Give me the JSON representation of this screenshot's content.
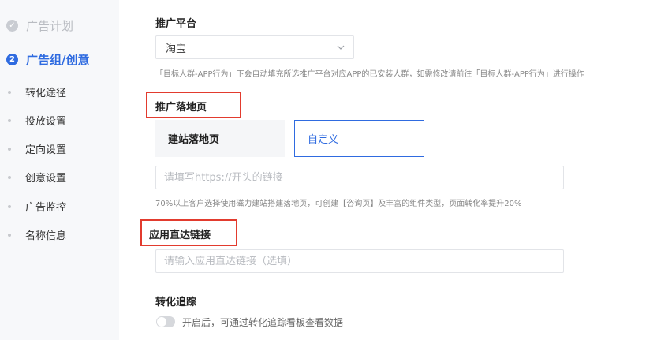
{
  "sidebar": {
    "step1": {
      "number": "✓",
      "label": "广告计划"
    },
    "step2": {
      "number": "2",
      "label": "广告组/创意"
    },
    "items": [
      {
        "label": "转化途径"
      },
      {
        "label": "投放设置"
      },
      {
        "label": "定向设置"
      },
      {
        "label": "创意设置"
      },
      {
        "label": "广告监控"
      },
      {
        "label": "名称信息"
      }
    ]
  },
  "platform": {
    "label": "推广平台",
    "selected": "淘宝",
    "hint": "「目标人群-APP行为」下会自动填充所选推广平台对应APP的已安装人群，如需修改请前往「目标人群-APP行为」进行操作"
  },
  "landing": {
    "label": "推广落地页",
    "tabs": [
      "建站落地页",
      "自定义"
    ],
    "url_placeholder": "请填写https://开头的链接",
    "hint": "70%以上客户选择使用磁力建站搭建落地页，可创建【咨询页】及丰富的组件类型，页面转化率提升20%"
  },
  "deeplink": {
    "label": "应用直达链接",
    "placeholder": "请输入应用直达链接（选填）"
  },
  "tracking": {
    "label": "转化追踪",
    "toggle_text": "开启后，可通过转化追踪看板查看数据",
    "enabled": false
  },
  "colors": {
    "accent": "#2f6be0",
    "highlight": "#e23b2e"
  }
}
